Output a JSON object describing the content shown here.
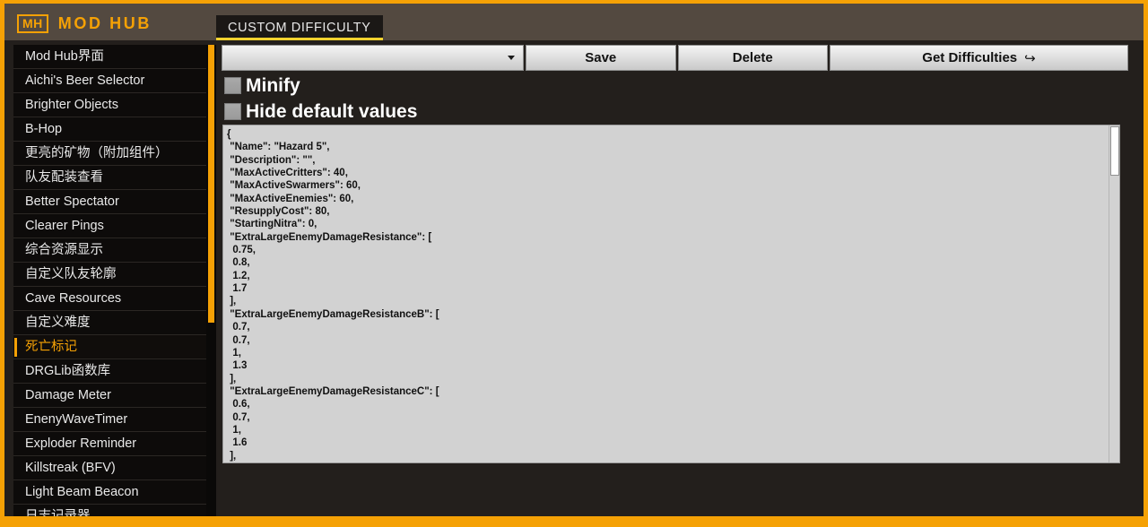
{
  "window": {
    "border_color": "#F5A105",
    "header_bg": "#534940",
    "content_bg": "#231f1c"
  },
  "header": {
    "brand_badge": "MH",
    "brand_title": "MOD HUB"
  },
  "tabs": [
    {
      "label": "CUSTOM DIFFICULTY",
      "active": true
    }
  ],
  "sidebar": {
    "selected_index": 12,
    "scrollbar": {
      "color": "#F5A105",
      "thumb_top": 0,
      "thumb_height": 310
    },
    "items": [
      {
        "label": "Mod Hub界面"
      },
      {
        "label": "Aichi's Beer Selector"
      },
      {
        "label": "Brighter Objects"
      },
      {
        "label": "B-Hop"
      },
      {
        "label": "更亮的矿物（附加组件）"
      },
      {
        "label": "队友配装查看"
      },
      {
        "label": "Better Spectator"
      },
      {
        "label": "Clearer Pings"
      },
      {
        "label": "综合资源显示"
      },
      {
        "label": "自定义队友轮廓"
      },
      {
        "label": "Cave Resources"
      },
      {
        "label": "自定义难度"
      },
      {
        "label": "死亡标记"
      },
      {
        "label": "DRGLib函数库"
      },
      {
        "label": "Damage Meter"
      },
      {
        "label": "EnenyWaveTimer"
      },
      {
        "label": "Exploder Reminder"
      },
      {
        "label": "Killstreak (BFV)"
      },
      {
        "label": "Light Beam Beacon"
      },
      {
        "label": "日志记录器"
      }
    ]
  },
  "toolbar": {
    "difficulty_select_value": "",
    "difficulty_select_placeholder": "",
    "save_label": "Save",
    "delete_label": "Delete",
    "get_difficulties_label": "Get Difficulties",
    "get_difficulties_glyph": "↪"
  },
  "options": {
    "minify": {
      "label": "Minify",
      "checked": false
    },
    "hide_default_values": {
      "label": "Hide default values",
      "checked": false
    }
  },
  "editor": {
    "json_text": "{\n \"Name\": \"Hazard 5\",\n \"Description\": \"\",\n \"MaxActiveCritters\": 40,\n \"MaxActiveSwarmers\": 60,\n \"MaxActiveEnemies\": 60,\n \"ResupplyCost\": 80,\n \"StartingNitra\": 0,\n \"ExtraLargeEnemyDamageResistance\": [\n  0.75,\n  0.8,\n  1.2,\n  1.7\n ],\n \"ExtraLargeEnemyDamageResistanceB\": [\n  0.7,\n  0.7,\n  1,\n  1.3\n ],\n \"ExtraLargeEnemyDamageResistanceC\": [\n  0.6,\n  0.7,\n  1,\n  1.6\n ],",
    "config_values": {
      "Name": "Hazard 5",
      "Description": "",
      "MaxActiveCritters": 40,
      "MaxActiveSwarmers": 60,
      "MaxActiveEnemies": 60,
      "ResupplyCost": 80,
      "StartingNitra": 0,
      "ExtraLargeEnemyDamageResistance": [
        0.75,
        0.8,
        1.2,
        1.7
      ],
      "ExtraLargeEnemyDamageResistanceB": [
        0.7,
        0.7,
        1,
        1.3
      ],
      "ExtraLargeEnemyDamageResistanceC": [
        0.6,
        0.7,
        1,
        1.6
      ]
    }
  }
}
